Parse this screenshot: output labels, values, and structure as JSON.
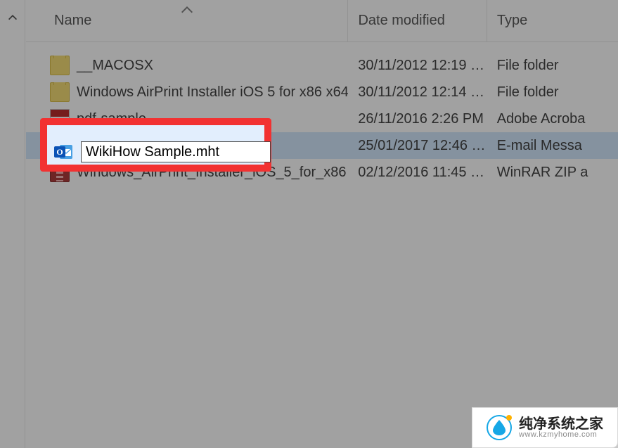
{
  "columns": {
    "name": "Name",
    "date": "Date modified",
    "type": "Type"
  },
  "rename_value": "WikiHow Sample.mht",
  "rows": [
    {
      "icon": "folder",
      "name": "__MACOSX",
      "date": "30/11/2012 12:19 …",
      "type": "File folder"
    },
    {
      "icon": "folder",
      "name": "Windows AirPrint Installer iOS 5 for x86 x64",
      "date": "30/11/2012 12:14 …",
      "type": "File folder"
    },
    {
      "icon": "pdf",
      "name": "pdf-sample",
      "date": "26/11/2016 2:26 PM",
      "type": "Adobe Acroba"
    },
    {
      "icon": "outlook",
      "name": "WikiHow Sample.mht",
      "date": "25/01/2017 12:46 …",
      "type": "E-mail Messa"
    },
    {
      "icon": "zip",
      "name": "Windows_AirPrint_Installer_iOS_5_for_x86…",
      "date": "02/12/2016 11:45 …",
      "type": "WinRAR ZIP a"
    }
  ],
  "brand": {
    "name": "纯净系统之家",
    "url": "www.kzmyhome.com"
  }
}
